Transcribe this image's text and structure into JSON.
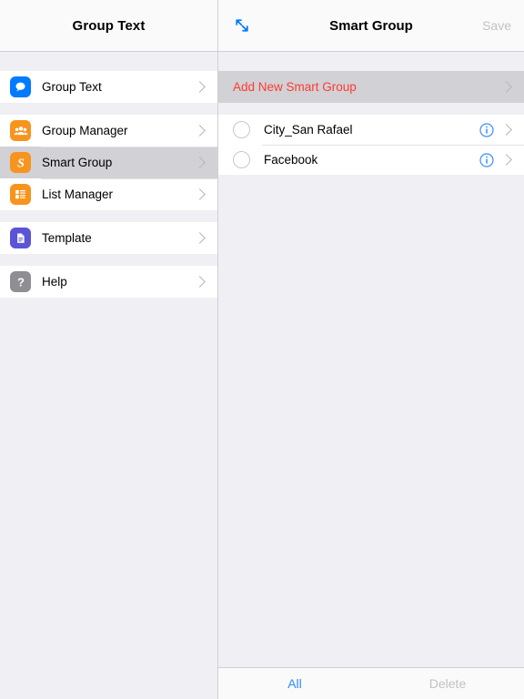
{
  "sidebar": {
    "header_title": "Group Text",
    "groups": [
      {
        "items": [
          {
            "label": "Group Text",
            "icon": "speech-bubble-icon",
            "color": "#007aff",
            "selected": false
          }
        ]
      },
      {
        "items": [
          {
            "label": "Group Manager",
            "icon": "people-group-icon",
            "color": "#f7941e",
            "selected": false
          },
          {
            "label": "Smart Group",
            "icon": "letter-s-icon",
            "color": "#f7941e",
            "selected": true
          },
          {
            "label": "List Manager",
            "icon": "list-grid-icon",
            "color": "#f7941e",
            "selected": false
          }
        ]
      },
      {
        "items": [
          {
            "label": "Template",
            "icon": "document-icon",
            "color": "#5a55d6",
            "selected": false
          }
        ]
      },
      {
        "items": [
          {
            "label": "Help",
            "icon": "question-mark-icon",
            "color": "#8e8e93",
            "selected": false
          }
        ]
      }
    ]
  },
  "detail": {
    "header": {
      "expand_icon": "expand-arrows-icon",
      "title": "Smart Group",
      "save_label": "Save"
    },
    "add_new_label": "Add New Smart Group",
    "rows": [
      {
        "label": "City_San Rafael",
        "selected": false
      },
      {
        "label": "Facebook",
        "selected": false
      }
    ],
    "toolbar": {
      "all_label": "All",
      "delete_label": "Delete"
    }
  },
  "colors": {
    "accent_blue": "#007aff",
    "toolbar_blue": "#2f8cf5",
    "destructive_red": "#ff3b30",
    "selected_row": "#d1d1d6",
    "panel_background": "#efeff4",
    "disabled_text": "#c2c2c7"
  }
}
